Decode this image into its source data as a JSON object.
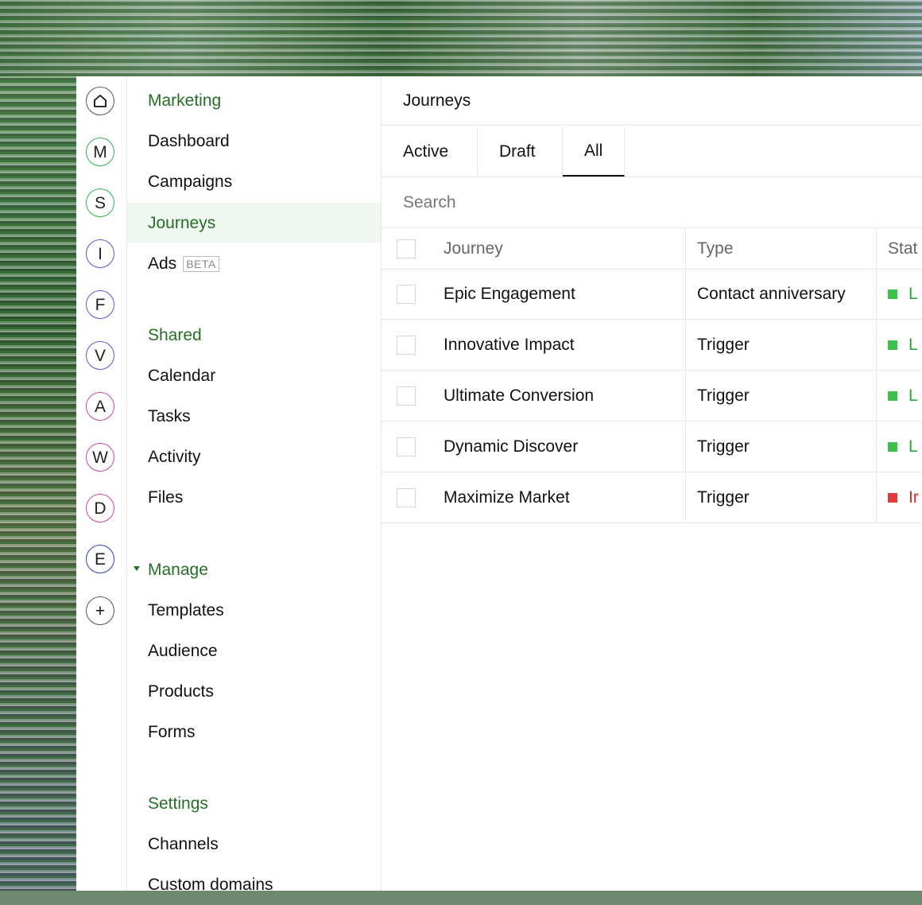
{
  "rail": {
    "items": [
      {
        "label": "",
        "icon": "home-icon",
        "color": "#555555"
      },
      {
        "label": "M",
        "color": "#2eb34a"
      },
      {
        "label": "S",
        "color": "#2eb34a"
      },
      {
        "label": "I",
        "color": "#6a4fd6"
      },
      {
        "label": "F",
        "color": "#6a4fd6"
      },
      {
        "label": "V",
        "color": "#6a4fd6"
      },
      {
        "label": "A",
        "color": "#d0479a"
      },
      {
        "label": "W",
        "color": "#d0479a"
      },
      {
        "label": "D",
        "color": "#d0479a"
      },
      {
        "label": "E",
        "color": "#2c3fb8"
      },
      {
        "label": "+",
        "icon": "plus-icon",
        "color": "#555555"
      }
    ]
  },
  "sidebar": {
    "marketing_heading": "Marketing",
    "marketing_items": [
      "Dashboard",
      "Campaigns",
      "Journeys",
      "Ads"
    ],
    "ads_badge": "BETA",
    "shared_heading": "Shared",
    "shared_items": [
      "Calendar",
      "Tasks",
      "Activity",
      "Files"
    ],
    "manage_heading": "Manage",
    "manage_items": [
      "Templates",
      "Audience",
      "Products",
      "Forms"
    ],
    "settings_heading": "Settings",
    "settings_items": [
      "Channels",
      "Custom domains"
    ],
    "active_item": "Journeys"
  },
  "main": {
    "title": "Journeys",
    "tabs": [
      "Active",
      "Draft",
      "All"
    ],
    "active_tab": "All",
    "search_placeholder": "Search",
    "columns": [
      "Journey",
      "Type",
      "Stat"
    ],
    "rows": [
      {
        "journey": "Epic Engagement",
        "type": "Contact anniversary",
        "status": "L",
        "status_color": "#3cc24b"
      },
      {
        "journey": "Innovative Impact",
        "type": "Trigger",
        "status": "L",
        "status_color": "#3cc24b"
      },
      {
        "journey": "Ultimate Conversion",
        "type": "Trigger",
        "status": "L",
        "status_color": "#3cc24b"
      },
      {
        "journey": "Dynamic Discover",
        "type": "Trigger",
        "status": "L",
        "status_color": "#3cc24b"
      },
      {
        "journey": "Maximize Market",
        "type": "Trigger",
        "status": "Ir",
        "status_color": "#e23b3b"
      }
    ]
  },
  "colors": {
    "accent": "#256f25",
    "active_bg": "#f1f7f1"
  }
}
